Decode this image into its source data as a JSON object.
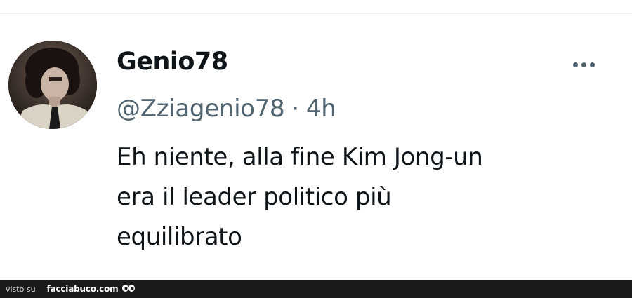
{
  "tweet": {
    "display_name": "Genio78",
    "handle": "@Zziagenio78",
    "separator": "·",
    "time": "4h",
    "text_lines": [
      "Eh niente, alla fine Kim Jong-un",
      "era il leader politico più",
      "equilibrato"
    ],
    "avatar_icon": "user-photo",
    "more_icon": "more-dots-icon"
  },
  "footer": {
    "prefix": "visto su",
    "site": "facciabuco.com",
    "logo_icon": "eyes-logo-icon"
  },
  "colors": {
    "text_primary": "#0f1419",
    "text_secondary": "#536471",
    "footer_background": "#1b1b1b"
  }
}
